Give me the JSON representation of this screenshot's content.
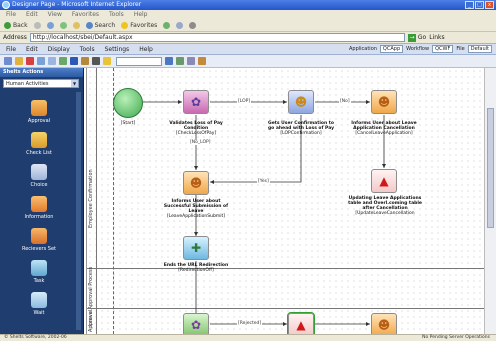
{
  "window": {
    "title": "Designer Page - Microsoft Internet Explorer",
    "controls": [
      "_",
      "□",
      "x"
    ]
  },
  "ie_menu": [
    "File",
    "Edit",
    "View",
    "Favorites",
    "Tools",
    "Help"
  ],
  "ie_toolbar": {
    "back": "Back",
    "search": "Search",
    "favorites": "Favorites"
  },
  "address": {
    "label": "Address",
    "url": "http://localhost/sbei/Default.aspx",
    "go": "Go",
    "links": "Links"
  },
  "app_menu": [
    "File",
    "Edit",
    "Display",
    "Tools",
    "Settings",
    "Help"
  ],
  "app_right": {
    "application_label": "Application",
    "application_value": "QCApp",
    "workflow_label": "Workflow",
    "workflow_value": "QCWF",
    "file_label": "File",
    "file_value": "Default"
  },
  "left_panel": {
    "header": "Shelts Actions",
    "category": "Human Activities",
    "actions": [
      "Approval",
      "Check List",
      "Choice",
      "Information",
      "Recievers Set",
      "Task",
      "Wait"
    ]
  },
  "lanes": [
    "Employee Confirmation",
    "Leave Approval Process",
    "Approval"
  ],
  "nodes": {
    "start": "[Start]",
    "n1_title": "Validates Loss of Pay Condition",
    "n1_sub": "[CheckLossOfPay]",
    "n2_title": "Gets User Confirmation to go ahead with Loss of Pay",
    "n2_sub": "[LOPConfirmation]",
    "n3_title": "Informs User about Leave Application Cancellation",
    "n3_sub": "[CancelLeaveApplication]",
    "n4_title": "Informs User about Successful Submission of Leave",
    "n4_sub": "[LeaveApplicationSubmit]",
    "n5_title": "Updating Leave Applications table and Overl.coming table after Cancellation",
    "n5_sub": "[UpdateLeaveCancellation",
    "n6_title": "Ends the URL Redirection",
    "n6_sub": "[RedirectionOff]"
  },
  "edges": {
    "e1": "[LOP]",
    "e2": "[No]",
    "e3": "[No_LOP]",
    "e4": "[Yes]",
    "e5": "[Rejected]"
  },
  "status": {
    "left": "© Shelts Software, 2002-06",
    "right": "No Pending Server Operations"
  },
  "colors": {
    "title_bar": "#2456c8",
    "side_panel": "#1f3d6e",
    "start_node": "#55c26a",
    "alert": "#d11818"
  }
}
